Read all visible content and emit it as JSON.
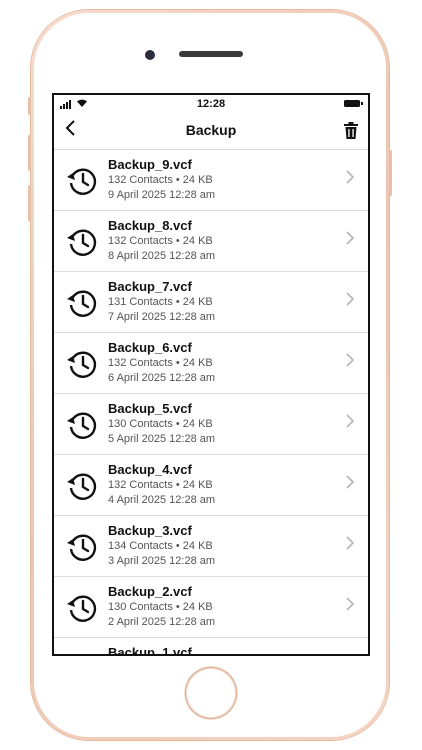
{
  "status_bar": {
    "time": "12:28"
  },
  "header": {
    "title": "Backup"
  },
  "icons": {
    "back": "chevron-left-icon",
    "trash": "trash-icon",
    "history": "history-icon",
    "chevron": "chevron-right-icon"
  },
  "colors": {
    "text": "#111111",
    "meta": "#555555",
    "divider": "#dcdcdc",
    "phone_frame": "#f1cdb8"
  },
  "backups": [
    {
      "name": "Backup_9.vcf",
      "details": "132 Contacts • 24 KB",
      "date": "9 April 2025 12:28 am"
    },
    {
      "name": "Backup_8.vcf",
      "details": "132 Contacts • 24 KB",
      "date": "8 April 2025 12:28 am"
    },
    {
      "name": "Backup_7.vcf",
      "details": "131 Contacts • 24 KB",
      "date": "7 April 2025 12:28 am"
    },
    {
      "name": "Backup_6.vcf",
      "details": "132 Contacts • 24 KB",
      "date": "6 April 2025 12:28 am"
    },
    {
      "name": "Backup_5.vcf",
      "details": "130 Contacts • 24 KB",
      "date": "5 April 2025 12:28 am"
    },
    {
      "name": "Backup_4.vcf",
      "details": "132 Contacts • 24 KB",
      "date": "4 April 2025 12:28 am"
    },
    {
      "name": "Backup_3.vcf",
      "details": "134 Contacts • 24 KB",
      "date": "3 April 2025 12:28 am"
    },
    {
      "name": "Backup_2.vcf",
      "details": "130 Contacts • 24 KB",
      "date": "2 April 2025 12:28 am"
    },
    {
      "name": "Backup_1.vcf",
      "details": "",
      "date": ""
    }
  ]
}
